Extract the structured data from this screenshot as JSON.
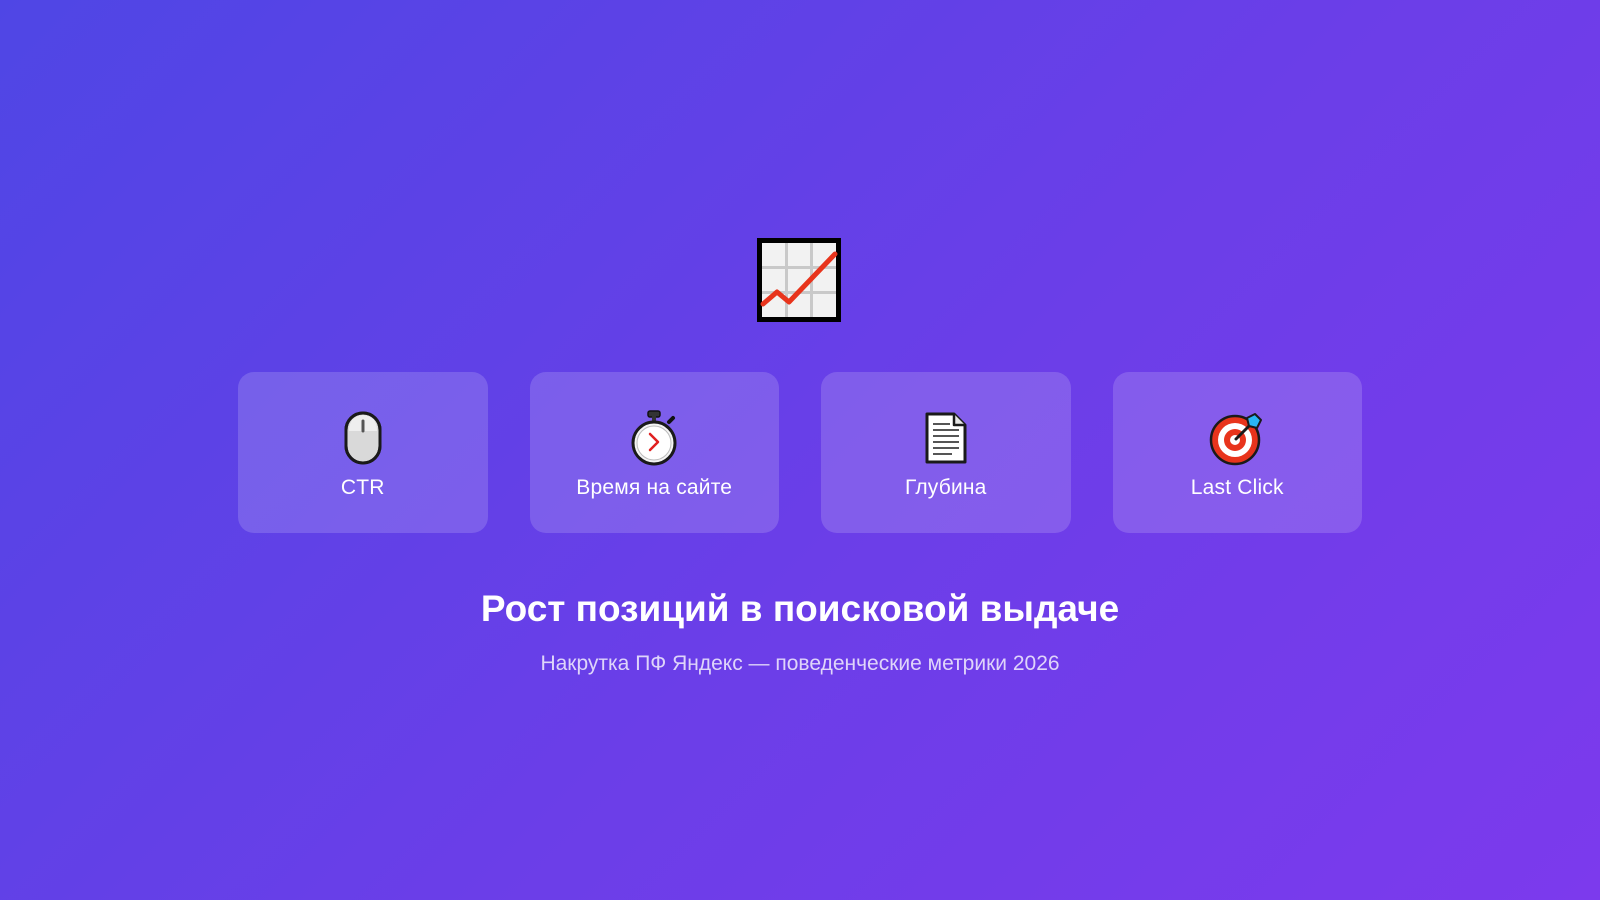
{
  "hero": {
    "icon": "chart-increasing-icon"
  },
  "metrics": [
    {
      "label": "CTR",
      "icon": "computer-mouse-icon"
    },
    {
      "label": "Время на сайте",
      "icon": "stopwatch-icon"
    },
    {
      "label": "Глубина",
      "icon": "page-document-icon"
    },
    {
      "label": "Last Click",
      "icon": "target-dart-icon"
    }
  ],
  "headline": "Рост позиций в поисковой выдаче",
  "subheadline": "Накрутка ПФ Яндекс — поведенческие метрики 2026",
  "colors": {
    "background_start": "#4f46e5",
    "background_end": "#7c3aed",
    "text": "#ffffff"
  }
}
